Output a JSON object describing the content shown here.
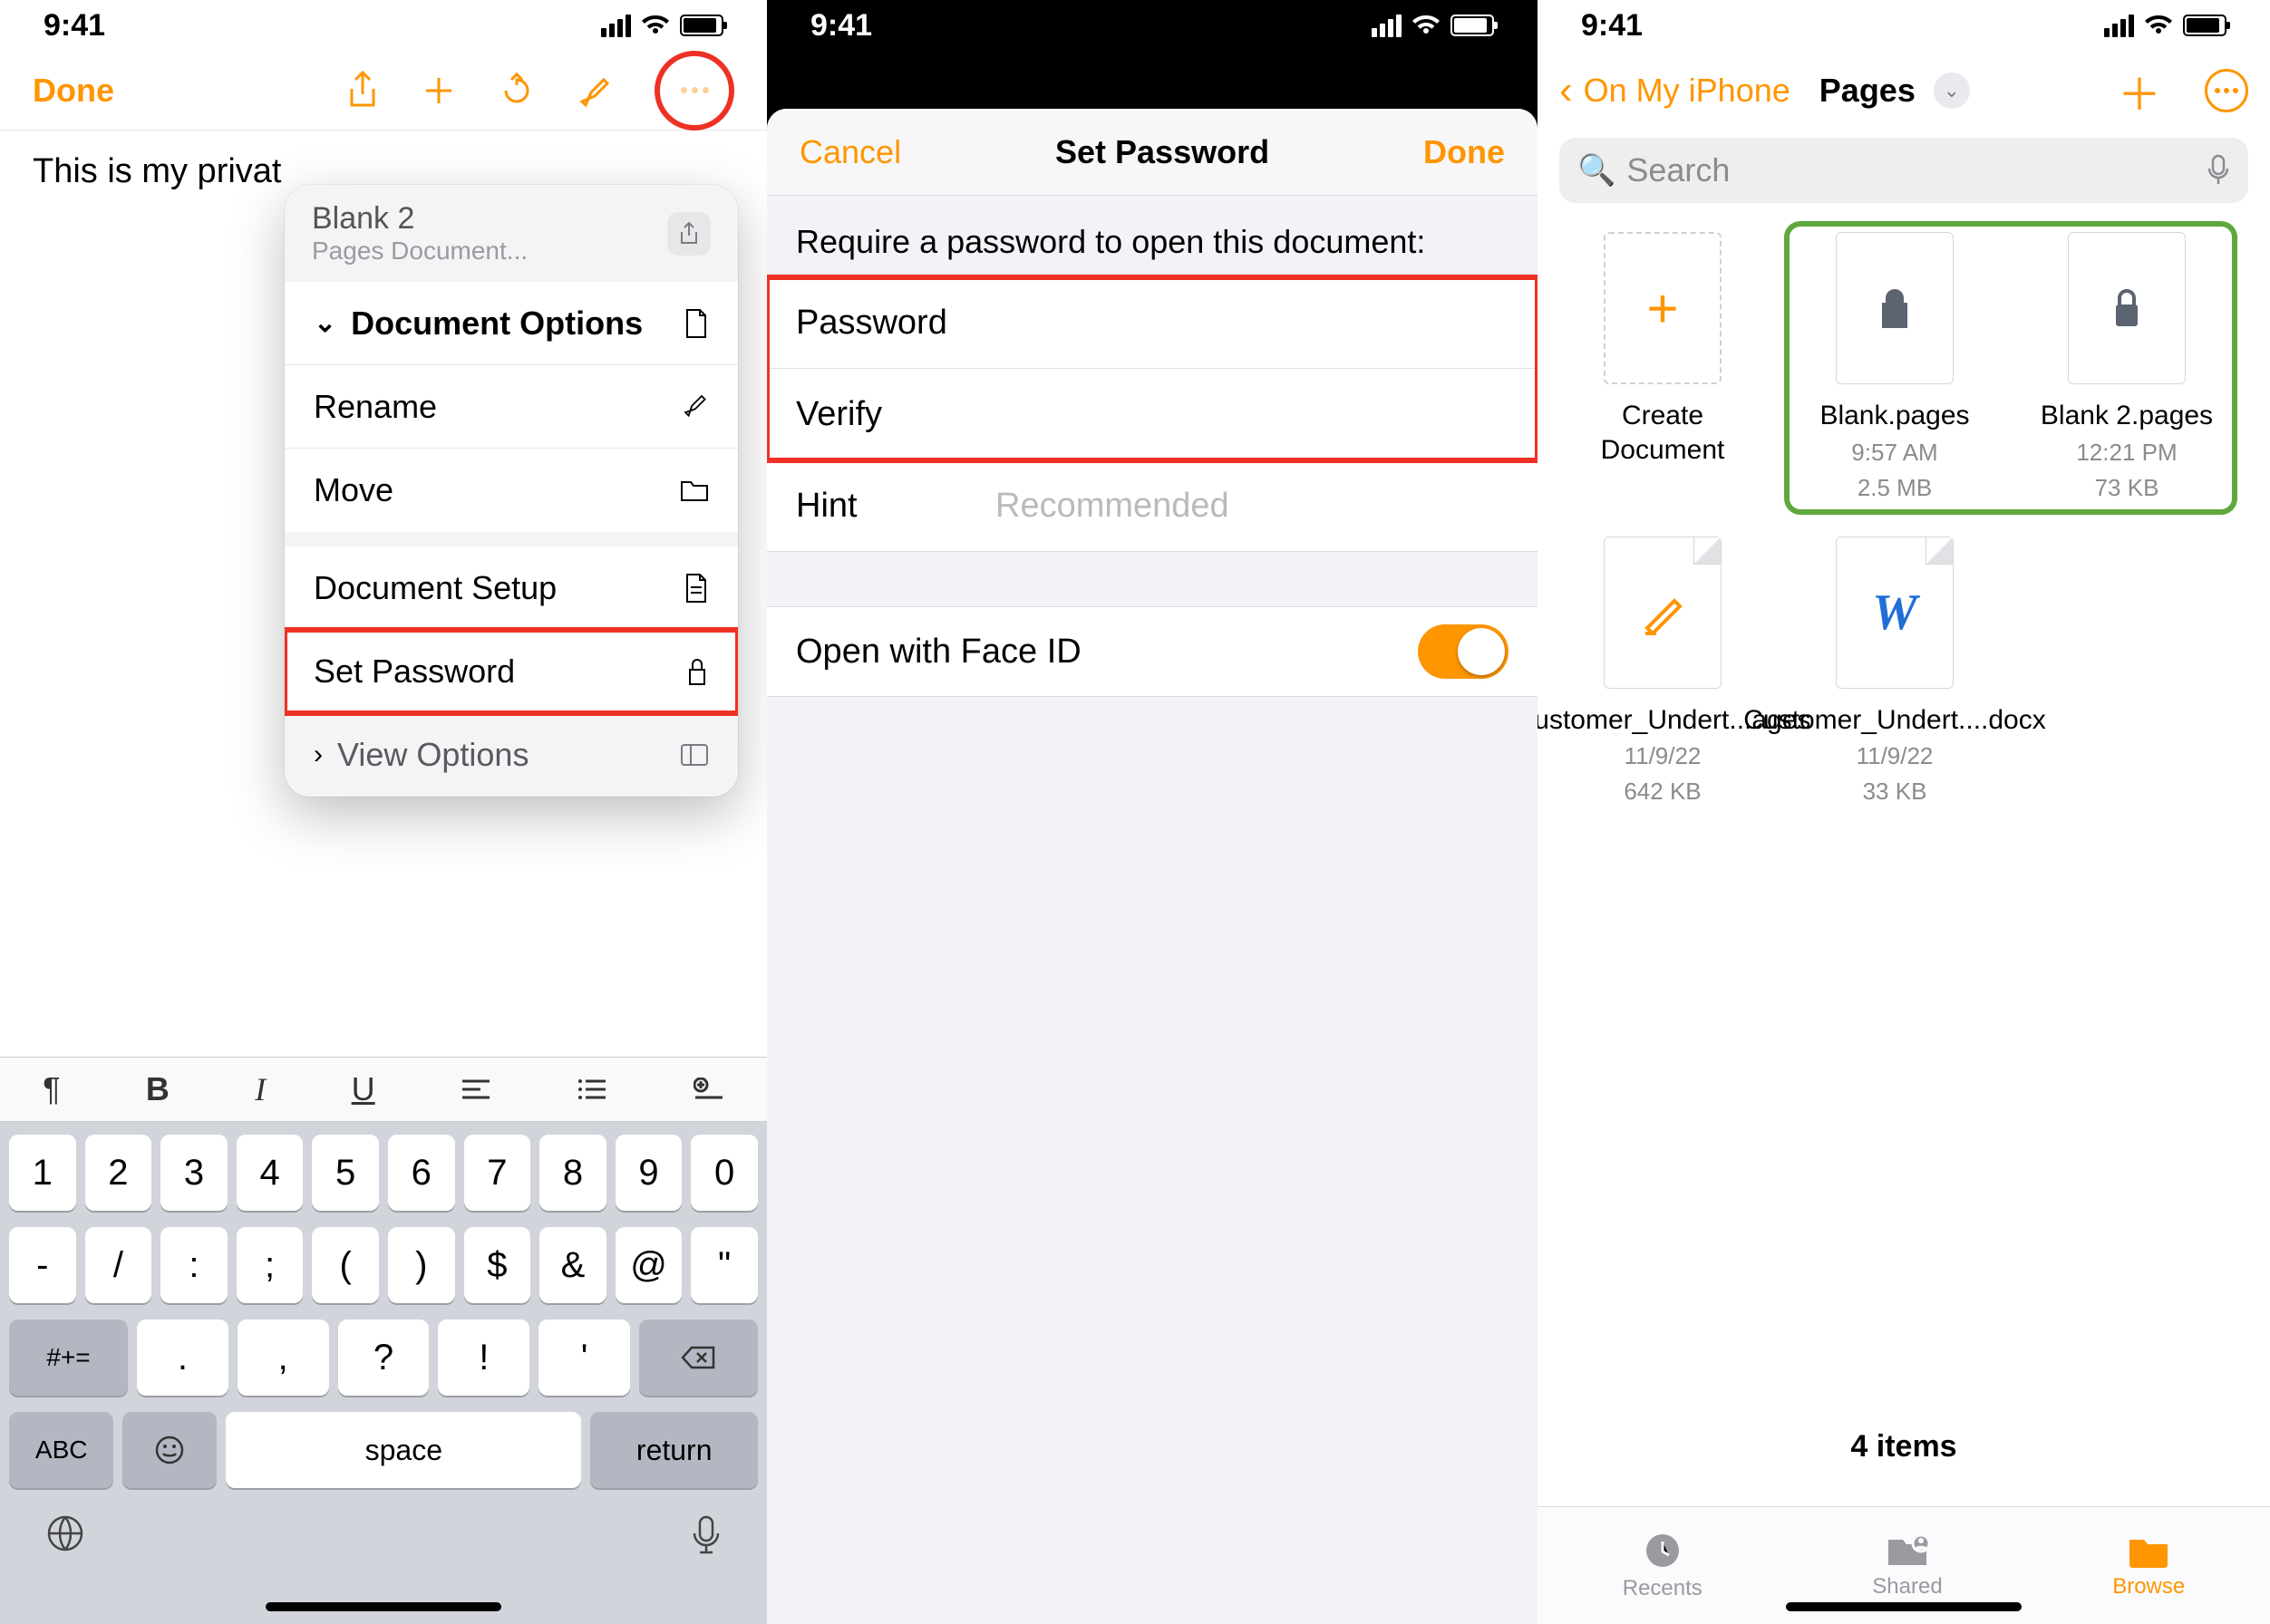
{
  "status": {
    "time": "9:41"
  },
  "phone1": {
    "done": "Done",
    "body_text": "This is my privat",
    "popover": {
      "doc_name": "Blank 2",
      "doc_sub": "Pages Document...",
      "doc_options": "Document Options",
      "rename": "Rename",
      "move": "Move",
      "doc_setup": "Document Setup",
      "set_password": "Set Password",
      "view_options": "View Options"
    },
    "keyboard": {
      "row1": [
        "1",
        "2",
        "3",
        "4",
        "5",
        "6",
        "7",
        "8",
        "9",
        "0"
      ],
      "row2": [
        "-",
        "/",
        ":",
        ";",
        "(",
        ")",
        "$",
        "&",
        "@",
        "\""
      ],
      "numalt": "#+=",
      "row3": [
        ".",
        ",",
        "?",
        "!",
        "'"
      ],
      "abc": "ABC",
      "space": "space",
      "ret": "return"
    }
  },
  "phone2": {
    "cancel": "Cancel",
    "title": "Set Password",
    "done": "Done",
    "require_label": "Require a password to open this document:",
    "password_label": "Password",
    "verify_label": "Verify",
    "hint_label": "Hint",
    "hint_placeholder": "Recommended",
    "faceid_label": "Open with Face ID"
  },
  "phone3": {
    "back": "On My iPhone",
    "title": "Pages",
    "search_placeholder": "Search",
    "create": "Create Document",
    "files": [
      {
        "name": "Blank.pages",
        "time": "9:57 AM",
        "size": "2.5 MB",
        "locked": true
      },
      {
        "name": "Blank 2.pages",
        "time": "12:21 PM",
        "size": "73 KB",
        "locked": true
      },
      {
        "name": "Customer_Undert...ages",
        "time": "11/9/22",
        "size": "642 KB",
        "pages_pencil": true
      },
      {
        "name": "Customer_Undert....docx",
        "time": "11/9/22",
        "size": "33 KB",
        "word": true
      }
    ],
    "count": "4 items",
    "tabs": {
      "recents": "Recents",
      "shared": "Shared",
      "browse": "Browse"
    }
  }
}
